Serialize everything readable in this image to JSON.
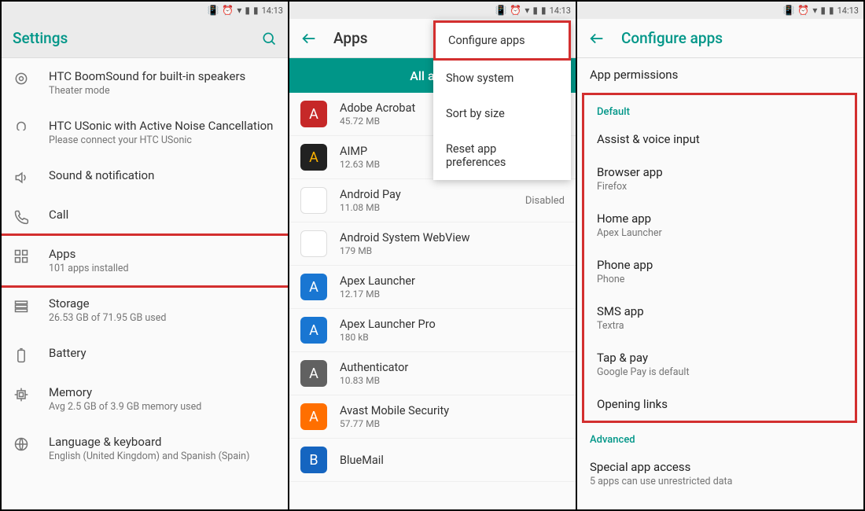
{
  "status": {
    "time": "14:13"
  },
  "screen1": {
    "title": "Settings",
    "items": [
      {
        "icon": "boomsound",
        "title": "HTC BoomSound for built-in speakers",
        "sub": "Theater mode"
      },
      {
        "icon": "usonic",
        "title": "HTC USonic with Active Noise Cancellation",
        "sub": "Please connect your HTC USonic"
      },
      {
        "icon": "sound",
        "title": "Sound & notification",
        "sub": ""
      },
      {
        "icon": "call",
        "title": "Call",
        "sub": ""
      },
      {
        "icon": "apps",
        "title": "Apps",
        "sub": "101 apps installed",
        "highlight": true
      },
      {
        "icon": "storage",
        "title": "Storage",
        "sub": "26.53 GB of 71.95 GB used"
      },
      {
        "icon": "battery",
        "title": "Battery",
        "sub": ""
      },
      {
        "icon": "memory",
        "title": "Memory",
        "sub": "Avg 2.5 GB of 3.9 GB memory used"
      },
      {
        "icon": "language",
        "title": "Language & keyboard",
        "sub": "English (United Kingdom) and Spanish (Spain)"
      }
    ]
  },
  "screen2": {
    "title": "Apps",
    "tab": "All apps",
    "menu": [
      {
        "label": "Configure apps",
        "highlight": true
      },
      {
        "label": "Show system"
      },
      {
        "label": "Sort by size"
      },
      {
        "label": "Reset app preferences"
      }
    ],
    "apps": [
      {
        "name": "Adobe Acrobat",
        "size": "45.72 MB",
        "color": "#c62828"
      },
      {
        "name": "AIMP",
        "size": "12.63 MB",
        "color": "#212121",
        "fg": "#ffb300"
      },
      {
        "name": "Android Pay",
        "size": "11.08 MB",
        "color": "#ffffff",
        "border": true,
        "status": "Disabled"
      },
      {
        "name": "Android System WebView",
        "size": "179 MB",
        "color": "#ffffff",
        "border": true
      },
      {
        "name": "Apex Launcher",
        "size": "12.17 MB",
        "color": "#1976d2"
      },
      {
        "name": "Apex Launcher Pro",
        "size": "180 kB",
        "color": "#1976d2"
      },
      {
        "name": "Authenticator",
        "size": "10.83 MB",
        "color": "#616161"
      },
      {
        "name": "Avast Mobile Security",
        "size": "57.77 MB",
        "color": "#ff6f00"
      },
      {
        "name": "BlueMail",
        "size": "",
        "color": "#1565c0"
      }
    ]
  },
  "screen3": {
    "title": "Configure apps",
    "top_item": "App permissions",
    "default_header": "Default",
    "defaults": [
      {
        "title": "Assist & voice input",
        "sub": ""
      },
      {
        "title": "Browser app",
        "sub": "Firefox"
      },
      {
        "title": "Home app",
        "sub": "Apex Launcher"
      },
      {
        "title": "Phone app",
        "sub": "Phone"
      },
      {
        "title": "SMS app",
        "sub": "Textra"
      },
      {
        "title": "Tap & pay",
        "sub": "Google Pay is default"
      },
      {
        "title": "Opening links",
        "sub": ""
      }
    ],
    "advanced_header": "Advanced",
    "advanced": {
      "title": "Special app access",
      "sub": "5 apps can use unrestricted data"
    }
  }
}
